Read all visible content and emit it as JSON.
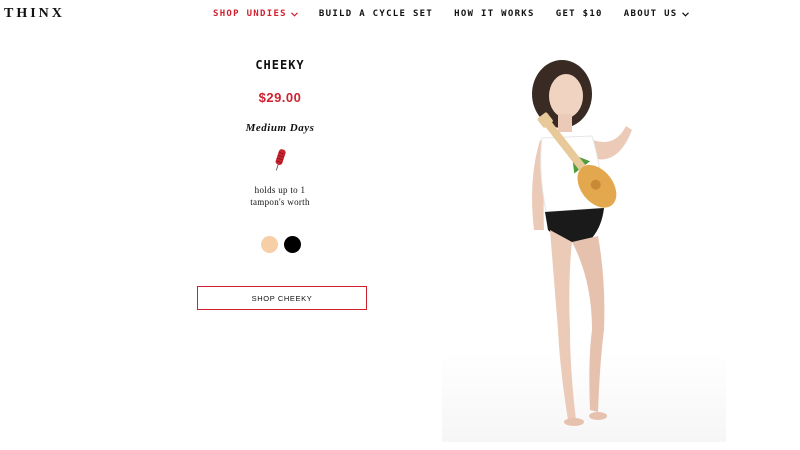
{
  "brand": {
    "logo": "THINX"
  },
  "nav": {
    "items": [
      {
        "label": "SHOP UNDIES",
        "active": true,
        "dropdown": true
      },
      {
        "label": "BUILD A CYCLE SET",
        "active": false,
        "dropdown": false
      },
      {
        "label": "HOW IT WORKS",
        "active": false,
        "dropdown": false
      },
      {
        "label": "GET $10",
        "active": false,
        "dropdown": false
      },
      {
        "label": "ABOUT US",
        "active": false,
        "dropdown": true
      }
    ]
  },
  "product": {
    "name": "CHEEKY",
    "price": "$29.00",
    "absorbency": "Medium Days",
    "absorbency_icon": "tampon-icon",
    "capacity_line1": "holds up to 1",
    "capacity_line2": "tampon's worth",
    "swatches": [
      {
        "color": "#f7cfa6",
        "name": "beige"
      },
      {
        "color": "#000000",
        "name": "black"
      }
    ],
    "shop_button": "SHOP CHEEKY"
  },
  "colors": {
    "accent": "#d0202f",
    "text": "#111111",
    "background": "#ffffff"
  }
}
